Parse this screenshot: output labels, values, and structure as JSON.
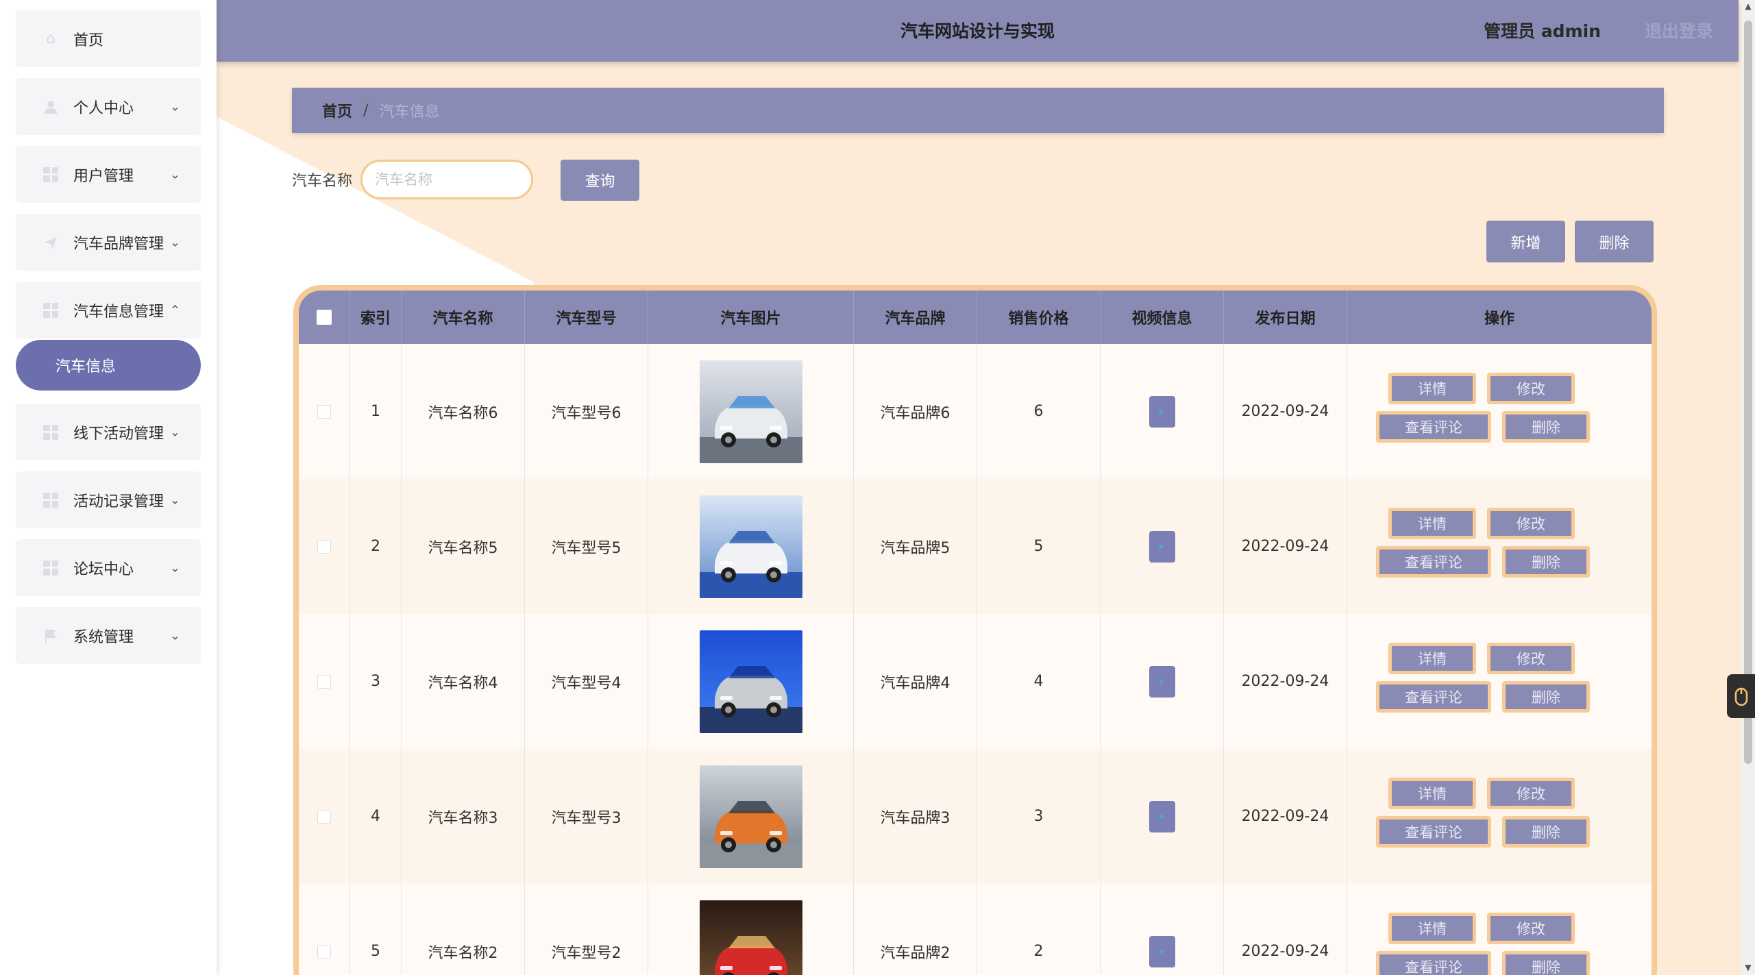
{
  "header": {
    "title": "汽车网站设计与实现",
    "user": "管理员 admin",
    "logout": "退出登录"
  },
  "sidebar": {
    "items": [
      {
        "label": "首页",
        "icon": "home-icon",
        "chevron": ""
      },
      {
        "label": "个人中心",
        "icon": "user-icon",
        "chevron": "⌄"
      },
      {
        "label": "用户管理",
        "icon": "grid-icon",
        "chevron": "⌄"
      },
      {
        "label": "汽车品牌管理",
        "icon": "send-icon",
        "chevron": "⌄"
      },
      {
        "label": "汽车信息管理",
        "icon": "grid-icon",
        "chevron": "⌃"
      },
      {
        "label": "线下活动管理",
        "icon": "grid-icon",
        "chevron": "⌄"
      },
      {
        "label": "活动记录管理",
        "icon": "grid-icon",
        "chevron": "⌄"
      },
      {
        "label": "论坛中心",
        "icon": "grid-icon",
        "chevron": "⌄"
      },
      {
        "label": "系统管理",
        "icon": "flag-icon",
        "chevron": "⌄"
      }
    ],
    "active_sub": "汽车信息"
  },
  "breadcrumb": {
    "home": "首页",
    "sep": "/",
    "current": "汽车信息"
  },
  "search": {
    "label": "汽车名称",
    "placeholder": "汽车名称",
    "value": "",
    "button": "查询"
  },
  "toolbar": {
    "add": "新增",
    "delete": "删除"
  },
  "table": {
    "columns": [
      "索引",
      "汽车名称",
      "汽车型号",
      "汽车图片",
      "汽车品牌",
      "销售价格",
      "视频信息",
      "发布日期",
      "操作"
    ],
    "rows": [
      {
        "index": "1",
        "name": "汽车名称6",
        "model": "汽车型号6",
        "brand": "汽车品牌6",
        "price": "6",
        "date": "2022-09-24",
        "image": "white-suv-charging"
      },
      {
        "index": "2",
        "name": "汽车名称5",
        "model": "汽车型号5",
        "brand": "汽车品牌5",
        "price": "5",
        "date": "2022-09-24",
        "image": "white-suv-blue-stage"
      },
      {
        "index": "3",
        "name": "汽车名称4",
        "model": "汽车型号4",
        "brand": "汽车品牌4",
        "price": "4",
        "date": "2022-09-24",
        "image": "silver-compact-blue"
      },
      {
        "index": "4",
        "name": "汽车名称3",
        "model": "汽车型号3",
        "brand": "汽车品牌3",
        "price": "3",
        "date": "2022-09-24",
        "image": "orange-suv"
      },
      {
        "index": "5",
        "name": "汽车名称2",
        "model": "汽车型号2",
        "brand": "汽车品牌2",
        "price": "2",
        "date": "2022-09-24",
        "image": "red-sportscar"
      }
    ],
    "actions": {
      "detail": "详情",
      "edit": "修改",
      "comments": "查看评论",
      "delete": "删除"
    }
  },
  "colors": {
    "accent": "#8a8bb4",
    "active": "#6b6fae",
    "peach": "#fdebd7",
    "border": "#f6cb97"
  }
}
